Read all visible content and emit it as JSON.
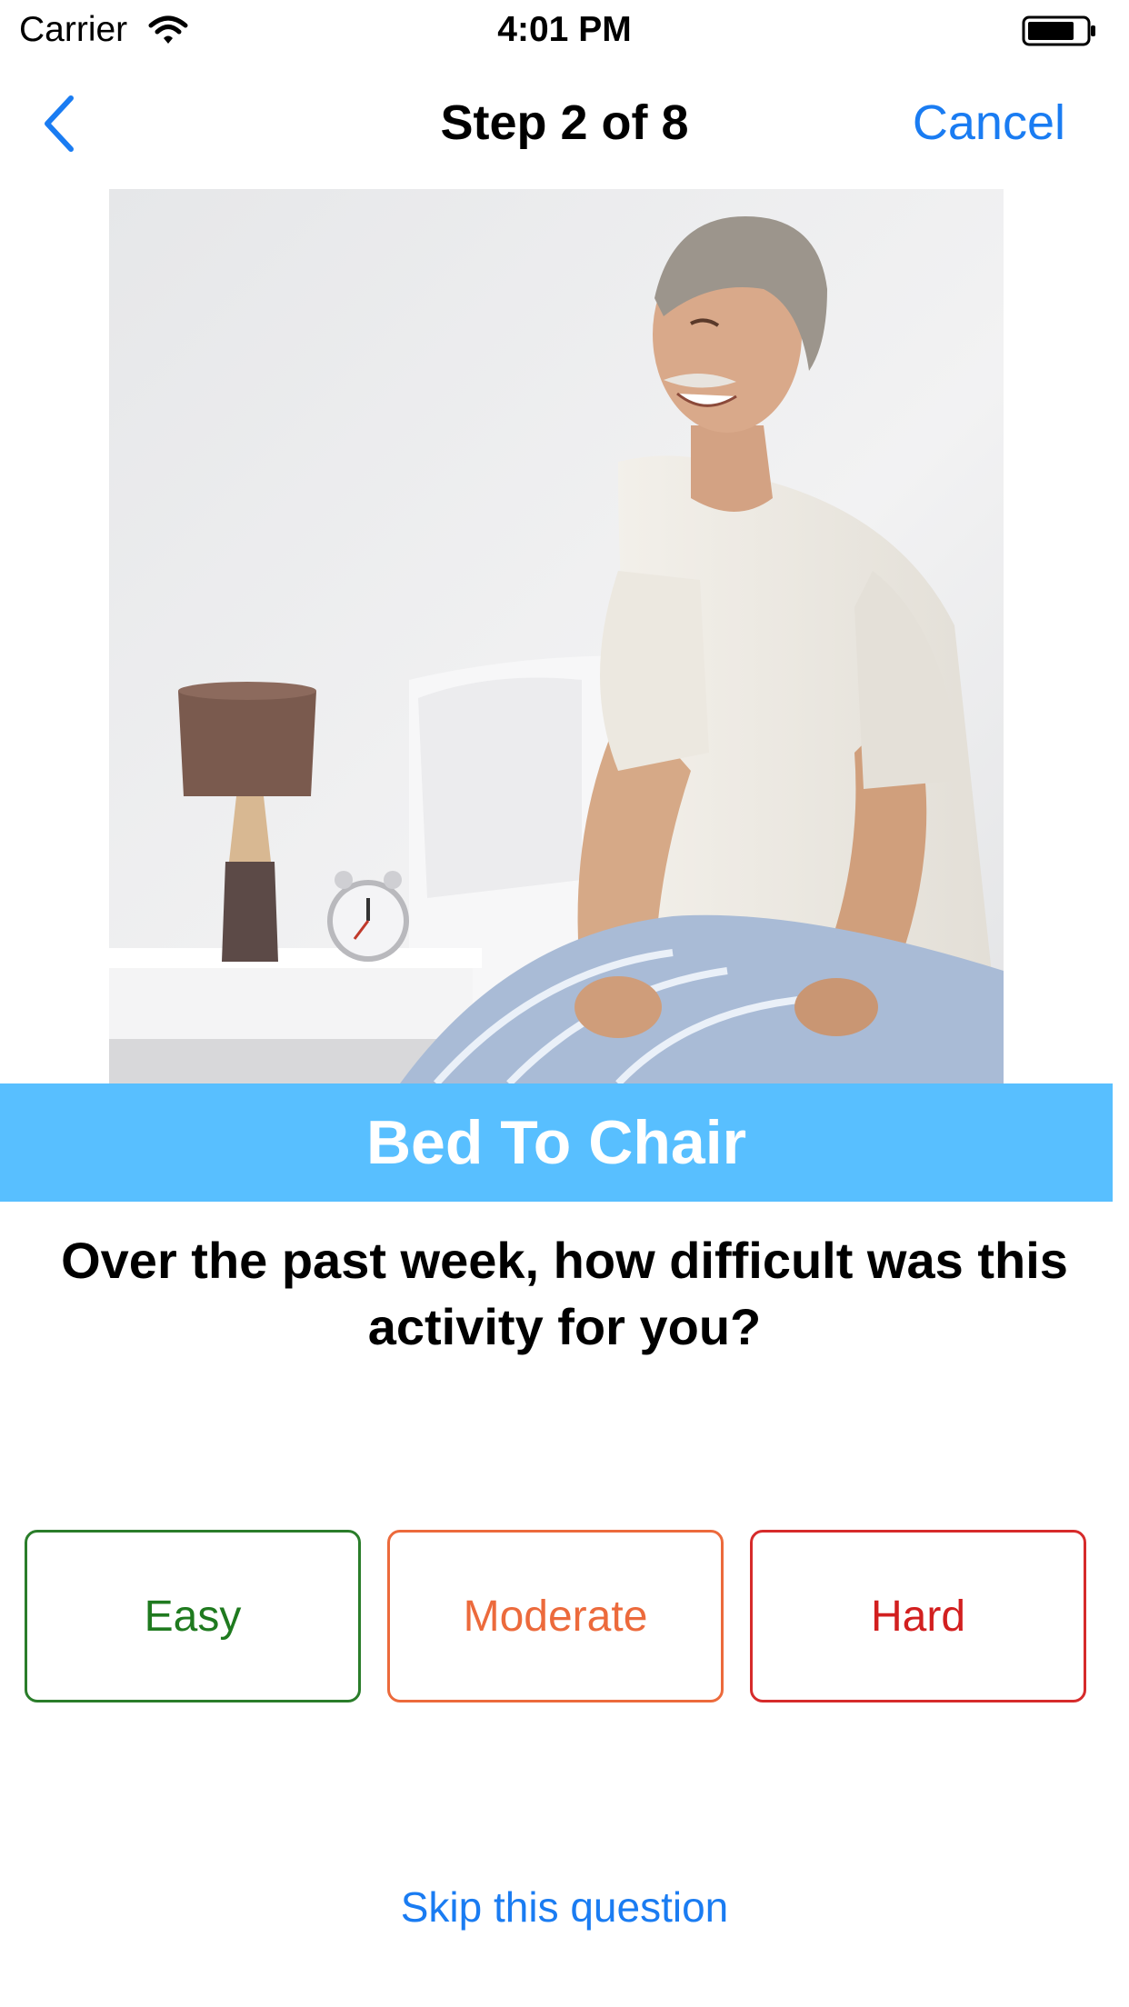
{
  "status_bar": {
    "carrier": "Carrier",
    "time": "4:01 PM",
    "icons": [
      "wifi-icon",
      "battery-icon"
    ]
  },
  "nav": {
    "back_icon": "chevron-left-icon",
    "title": "Step 2 of 8",
    "cancel_label": "Cancel"
  },
  "illustration": {
    "icon": "photo-senior-man-sitting-on-bed"
  },
  "activity": {
    "title": "Bed To Chair"
  },
  "question": {
    "text": "Over the past week, how difficult was this activity for you?"
  },
  "answers": [
    {
      "label": "Easy",
      "color": "#1f7a1f"
    },
    {
      "label": "Moderate",
      "color": "#ec6a3c"
    },
    {
      "label": "Hard",
      "color": "#d21f1f"
    }
  ],
  "skip": {
    "label": "Skip this question"
  },
  "colors": {
    "accent": "#1a7cf2",
    "banner": "#58bfff"
  }
}
